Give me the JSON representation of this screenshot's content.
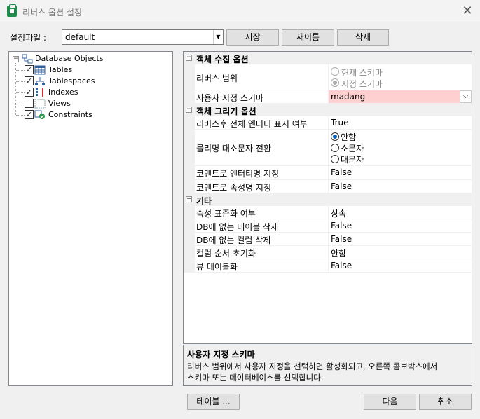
{
  "window": {
    "title": "리버스 옵션 설정"
  },
  "settings_file": {
    "label": "설정파일 :",
    "value": "default"
  },
  "buttons": {
    "save": "저장",
    "new_name": "새이름",
    "delete": "삭제",
    "table": "테이블 ...",
    "next": "다음",
    "cancel": "취소"
  },
  "tree": {
    "root": "Database Objects",
    "items": [
      {
        "label": "Tables",
        "checked": true
      },
      {
        "label": "Tablespaces",
        "checked": true
      },
      {
        "label": "Indexes",
        "checked": true
      },
      {
        "label": "Views",
        "checked": false
      },
      {
        "label": "Constraints",
        "checked": true
      }
    ]
  },
  "grid": {
    "cat1": {
      "title": "객체 수집 옵션",
      "scope_name": "리버스 범위",
      "scope_options": [
        "현재 스키마",
        "지정 스키마"
      ],
      "scope_selected": 1,
      "schema_name": "사용자 지정 스키마",
      "schema_value": "madang"
    },
    "cat2": {
      "title": "객체 그리기 옵션",
      "show_all_name": "리버스후 전체 엔터티 표시 여부",
      "show_all_value": "True",
      "case_name": "물리명 대소문자 전환",
      "case_options": [
        "안함",
        "소문자",
        "대문자"
      ],
      "case_selected": 0,
      "entity_comment_name": "코멘트로 엔터티명 지정",
      "entity_comment_value": "False",
      "attr_comment_name": "코멘트로 속성명 지정",
      "attr_comment_value": "False"
    },
    "cat3": {
      "title": "기타",
      "rows": [
        {
          "name": "속성 표준화 여부",
          "value": "상속"
        },
        {
          "name": "DB에 없는 테이블 삭제",
          "value": "False"
        },
        {
          "name": "DB에 없는 컬럼 삭제",
          "value": "False"
        },
        {
          "name": "컬럼 순서 초기화",
          "value": "안함"
        },
        {
          "name": "뷰 테이블화",
          "value": "False"
        }
      ]
    }
  },
  "description": {
    "title": "사용자 지정 스키마",
    "line1": "리버스 범위에서 사용자 지정을 선택하면 활성화되고, 오른쪽 콤보박스에서",
    "line2": "스키마 또는 데이터베이스를 선택합니다."
  },
  "colors": {
    "highlight_cell": "#ffd0d0",
    "radio_selected": "#0060c0"
  }
}
